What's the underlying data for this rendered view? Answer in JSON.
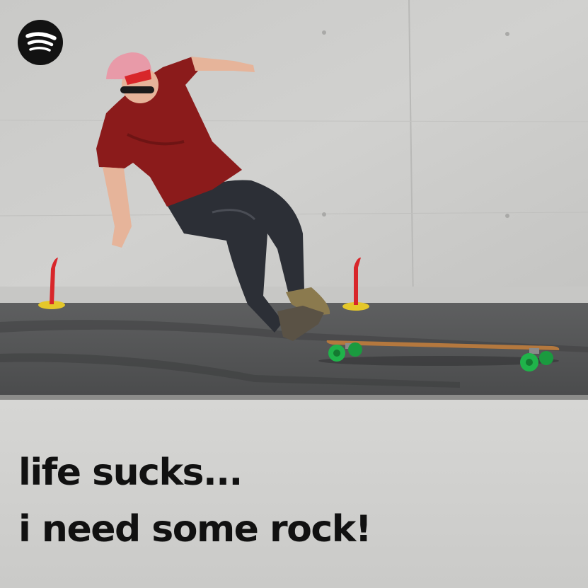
{
  "brand": {
    "logo_icon": "spotify-logo-icon",
    "logo_color": "#121212"
  },
  "title": {
    "line1": "life sucks...",
    "line2": "i need some rock!"
  },
  "photo": {
    "wall_color": "#cbcbc9",
    "ground_color": "#545556",
    "shirt_color": "#8b1b1b",
    "cap_color": "#e89aa8",
    "board_wheel_color": "#1fb34a",
    "cone_color": "#d8262a"
  }
}
